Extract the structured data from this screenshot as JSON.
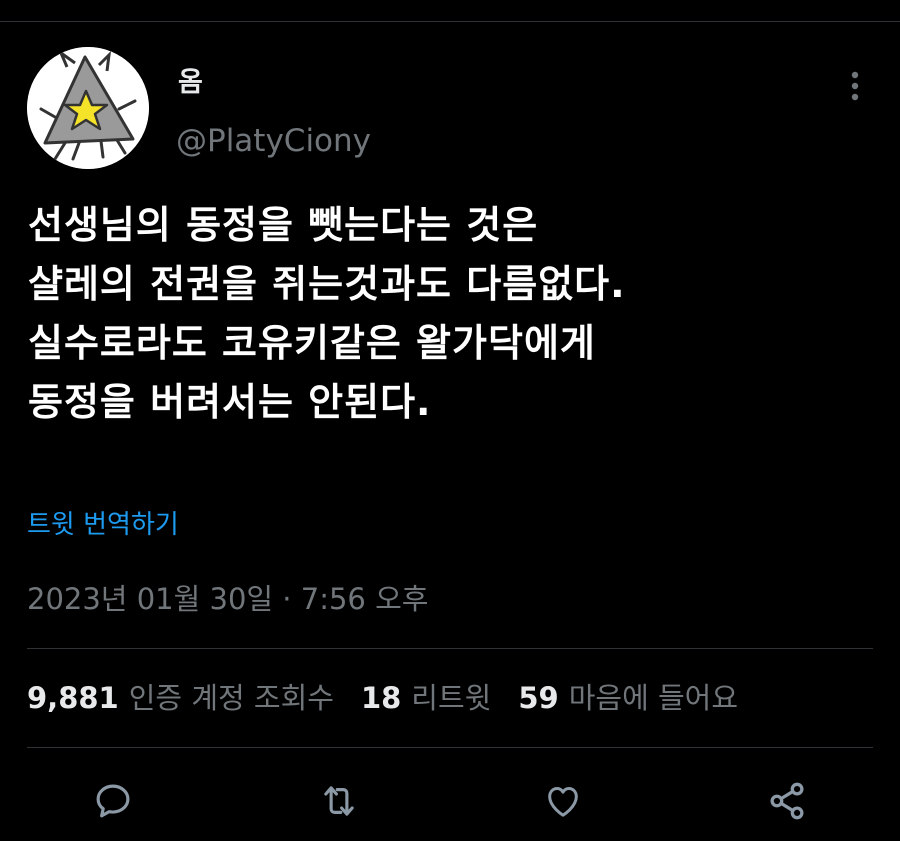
{
  "tweet": {
    "display_name": "옴",
    "handle": "@PlatyCiony",
    "text": "선생님의 동정을 뺏는다는 것은\n샬레의 전권을 쥐는것과도 다름없다.\n실수로라도 코유키같은 왈가닥에게\n동정을 버려서는 안된다.",
    "translate_label": "트윗 번역하기",
    "timestamp": "2023년 01월 30일 · 7:56 오후"
  },
  "stats": {
    "views_count": "9,881",
    "views_label": "인증 계정 조회수",
    "retweets_count": "18",
    "retweets_label": "리트윗",
    "likes_count": "59",
    "likes_label": "마음에 들어요"
  },
  "icons": {
    "more": "more-vertical-icon",
    "reply": "reply-icon",
    "retweet": "retweet-icon",
    "like": "heart-icon",
    "share": "share-icon"
  },
  "colors": {
    "background": "#000000",
    "text_primary": "#e7e9ea",
    "text_secondary": "#71767b",
    "link": "#1d9bf0",
    "divider": "#2f3336",
    "avatar_star": "#f5e32a"
  }
}
